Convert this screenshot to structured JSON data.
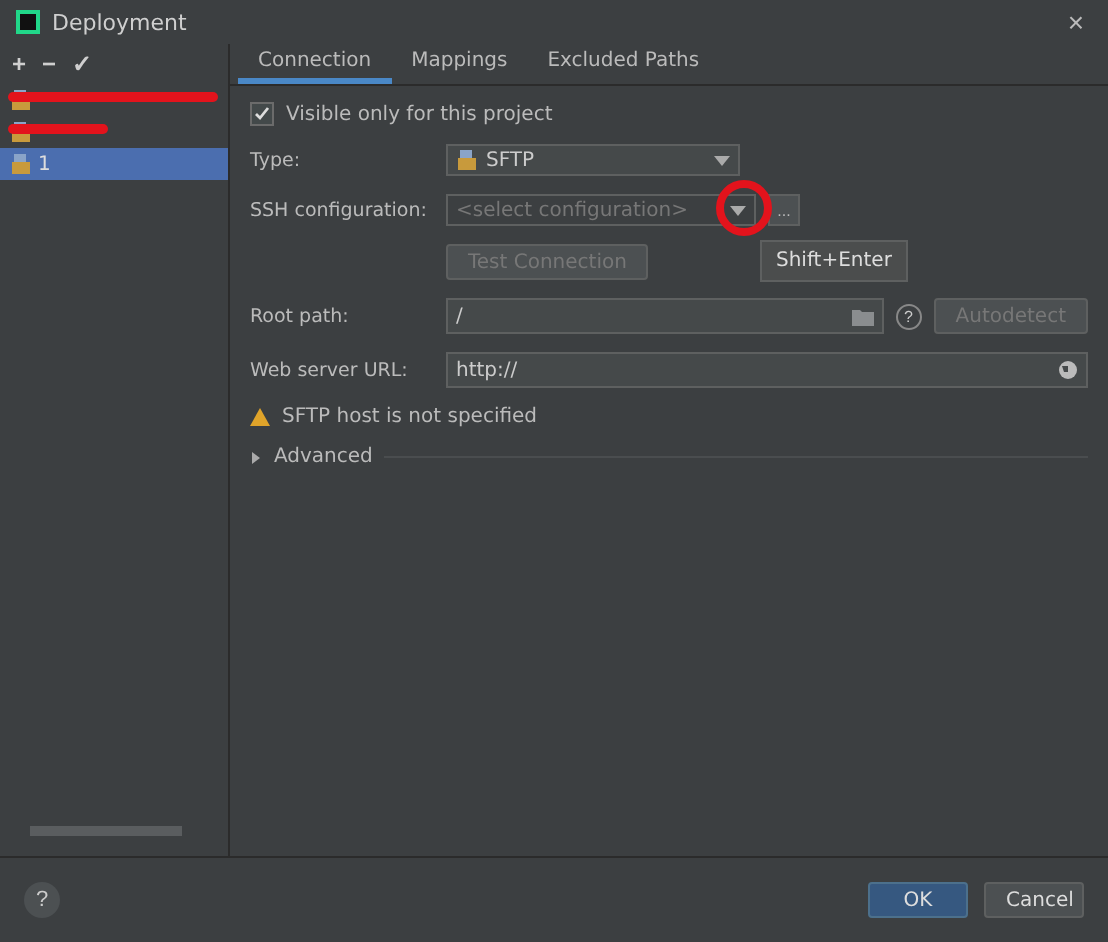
{
  "window": {
    "title": "Deployment",
    "close": "×"
  },
  "toolbar": [
    "+",
    "−",
    "✓"
  ],
  "servers": [
    {
      "selected": false,
      "redacted": true
    },
    {
      "selected": false,
      "redacted": true
    },
    {
      "name": "1",
      "selected": true,
      "redacted": false
    }
  ],
  "tabs": [
    {
      "label": "Connection",
      "selected": true
    },
    {
      "label": "Mappings",
      "selected": false
    },
    {
      "label": "Excluded Paths",
      "selected": false
    }
  ],
  "visible_only": {
    "label": "Visible only for this project",
    "checked": true
  },
  "type": {
    "label": "Type:",
    "value": "SFTP"
  },
  "ssh": {
    "label": "SSH configuration:",
    "placeholder": "<select configuration>",
    "browse": "...",
    "tooltip": "Shift+Enter",
    "test": "Test Connection",
    "disabled": true
  },
  "root_path": {
    "label": "Root path:",
    "value": "/",
    "help": "?",
    "autodetect": "Autodetect"
  },
  "web_url": {
    "label": "Web server URL:",
    "value": "http://"
  },
  "warning": "SFTP host is not specified",
  "advanced": {
    "label": "Advanced",
    "expanded": false
  },
  "footer": {
    "help": "?",
    "ok": "OK",
    "cancel": "Cancel"
  }
}
